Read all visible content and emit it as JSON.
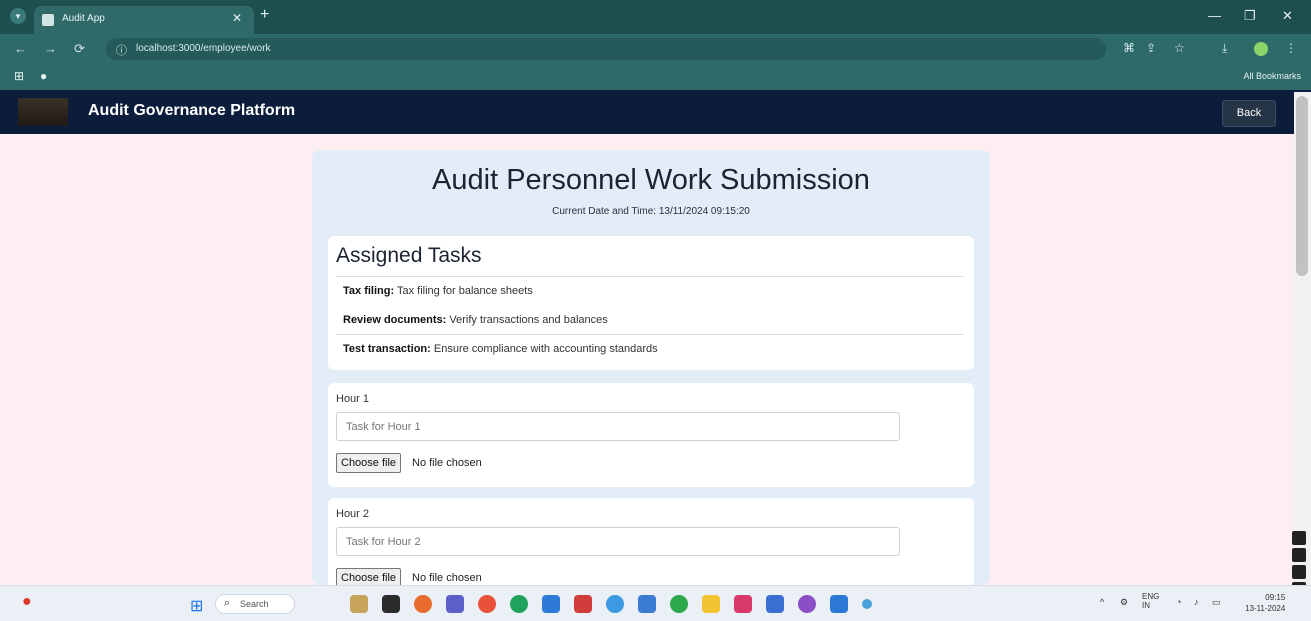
{
  "browser": {
    "tab_title": "Audit App",
    "url": "localhost:3000/employee/work",
    "all_bookmarks": "All Bookmarks"
  },
  "app": {
    "title": "Audit Governance Platform",
    "back_label": "Back"
  },
  "page": {
    "title": "Audit Personnel Work Submission",
    "datetime": "Current Date and Time: 13/11/2024 09:15:20"
  },
  "tasks": {
    "heading": "Assigned Tasks",
    "items": [
      {
        "name": "Tax filing:",
        "desc": "Tax filing for balance sheets"
      },
      {
        "name": "Review documents:",
        "desc": "Verify transactions and balances"
      },
      {
        "name": "Test transaction:",
        "desc": "Ensure compliance with accounting standards"
      }
    ]
  },
  "hours": [
    {
      "label": "Hour 1",
      "placeholder": "Task for Hour 1",
      "file_button": "Choose file",
      "file_status": "No file chosen"
    },
    {
      "label": "Hour 2",
      "placeholder": "Task for Hour 2",
      "file_button": "Choose file",
      "file_status": "No file chosen"
    }
  ],
  "taskbar": {
    "search_label": "Search",
    "clock_time": "09:15",
    "clock_date": "13-11-2024",
    "lang": "ENG IN"
  },
  "colors": {
    "chrome_dark": "#1d4f4f",
    "chrome": "#2d6a69",
    "app_header": "#0b1d3a",
    "page_bg": "#fdeef1",
    "card_bg": "#e3edf8"
  }
}
